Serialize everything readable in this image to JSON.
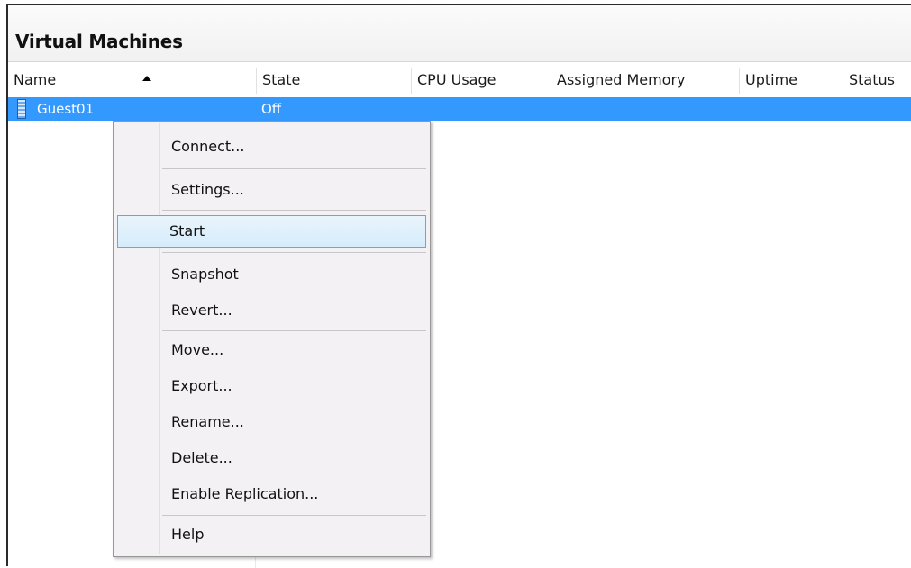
{
  "panel": {
    "title": "Virtual Machines"
  },
  "columns": [
    {
      "label": "Name"
    },
    {
      "label": "State"
    },
    {
      "label": "CPU Usage"
    },
    {
      "label": "Assigned Memory"
    },
    {
      "label": "Uptime"
    },
    {
      "label": "Status"
    }
  ],
  "sort": {
    "column": "Name",
    "direction": "ascending",
    "icon": "sort-ascending-icon"
  },
  "rows": [
    {
      "icon": "virtual-machine-icon",
      "name": "Guest01",
      "state": "Off",
      "selected": true
    }
  ],
  "context_menu": {
    "items": [
      {
        "label": "Connect..."
      },
      {
        "label": "Settings..."
      },
      {
        "label": "Start",
        "highlighted": true
      },
      {
        "label": "Snapshot"
      },
      {
        "label": "Revert..."
      },
      {
        "label": "Move..."
      },
      {
        "label": "Export..."
      },
      {
        "label": "Rename..."
      },
      {
        "label": "Delete..."
      },
      {
        "label": "Enable Replication..."
      },
      {
        "label": "Help"
      }
    ]
  },
  "colors": {
    "selection": "#3399ff",
    "menu_background": "#f4f1f4",
    "menu_highlight_border": "#6ba6d8"
  }
}
